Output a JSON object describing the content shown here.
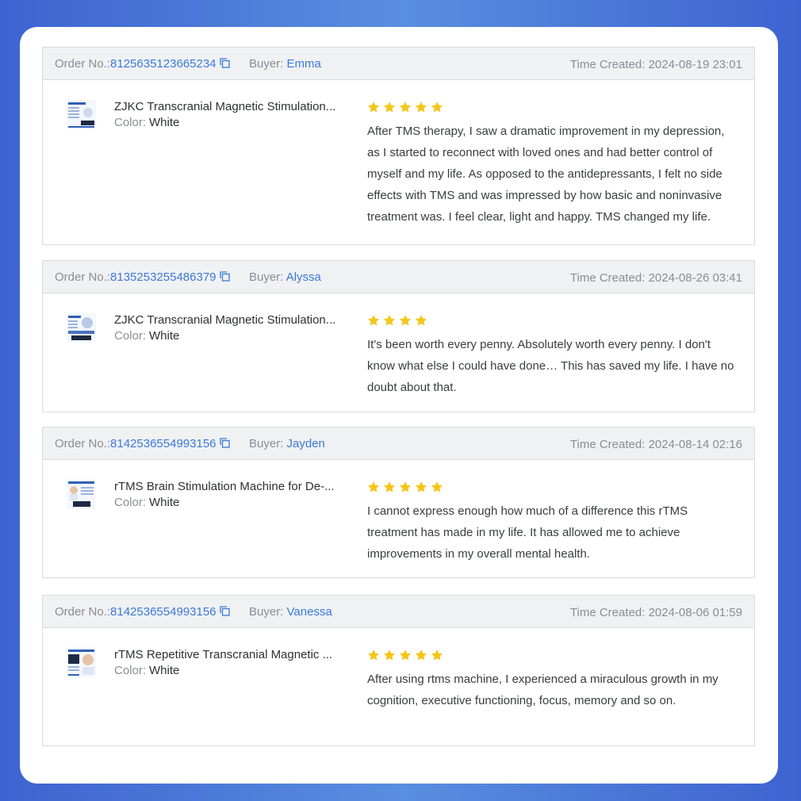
{
  "labels": {
    "order_no": "Order No.:",
    "buyer": "Buyer:",
    "time_created": "Time Created:",
    "color": "Color:"
  },
  "colors": {
    "star": "#f5c518",
    "link": "#3b7ad8",
    "header_bg": "#f0f1f3"
  },
  "icons": {
    "copy": "copy-icon",
    "star": "star-icon"
  },
  "orders": [
    {
      "order_no": "8125635123665234",
      "buyer": "Emma",
      "time_created": "2024-08-19 23:01",
      "product_name": "ZJKC Transcranial Magnetic Stimulation...",
      "color": "White",
      "rating": 5,
      "review": "After TMS therapy, I saw a dramatic improvement in my depression, as I started to reconnect with loved ones and had better control of myself and my life. As opposed to the antidepressants, I felt no side effects with TMS and was impressed by how basic and noninvasive treatment was. I feel clear, light and happy. TMS changed my life."
    },
    {
      "order_no": "8135253255486379",
      "buyer": "Alyssa",
      "time_created": "2024-08-26 03:41",
      "product_name": "ZJKC Transcranial Magnetic Stimulation...",
      "color": "White",
      "rating": 4,
      "review": "It's been worth every penny. Absolutely worth every penny. I don't know what else I could have done… This has saved my life. I have no doubt about that."
    },
    {
      "order_no": "8142536554993156",
      "buyer": "Jayden",
      "time_created": "2024-08-14 02:16",
      "product_name": "rTMS Brain Stimulation Machine for De-...",
      "color": "White",
      "rating": 5,
      "review": "I cannot express enough how much of a difference this rTMS treatment has made in my life. It has allowed me to achieve improvements in my overall mental health."
    },
    {
      "order_no": "8142536554993156",
      "buyer": "Vanessa",
      "time_created": "2024-08-06 01:59",
      "product_name": "rTMS Repetitive Transcranial Magnetic ...",
      "color": "White",
      "rating": 5,
      "review": "After using rtms machine, I experienced a miraculous growth in my cognition, executive functioning, focus, memory and so on."
    }
  ]
}
